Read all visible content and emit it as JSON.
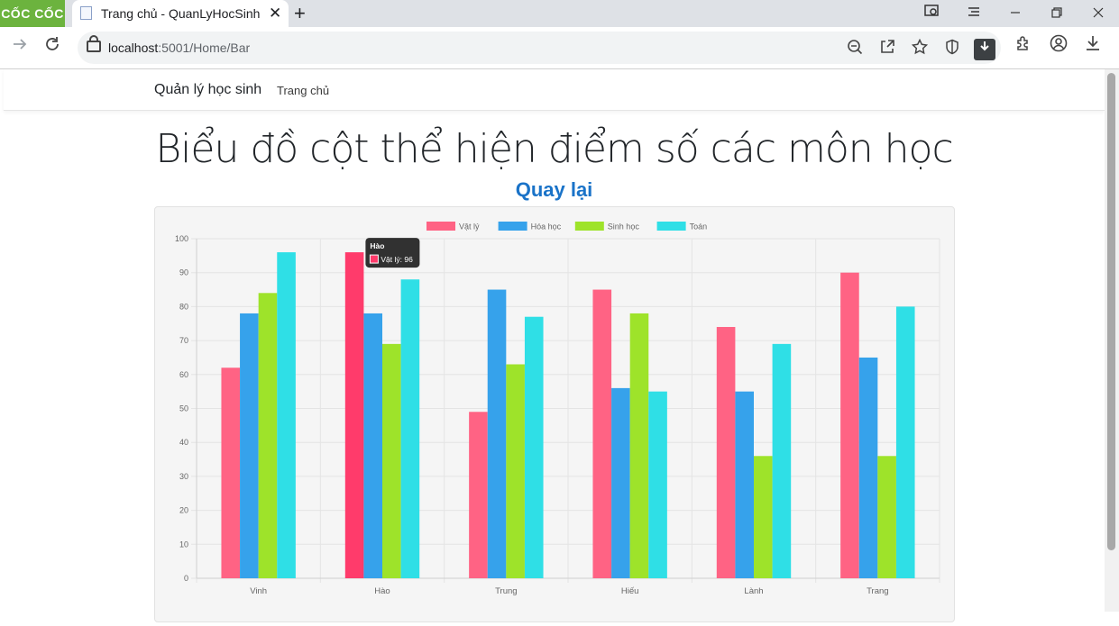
{
  "browser": {
    "brand": "CỐC CỐC",
    "tab_title": "Trang chủ - QuanLyHocSinh",
    "tab_close": "✕",
    "new_tab": "+",
    "url_host": "localhost",
    "url_path": ":5001/Home/Bar"
  },
  "navbar": {
    "brand": "Quản lý học sinh",
    "link_home": "Trang chủ"
  },
  "page": {
    "heading": "Biểu đồ cột thể hiện điểm số các môn học",
    "back_link": "Quay lại"
  },
  "tooltip": {
    "title": "Hào",
    "label": "Vật lý: 96"
  },
  "chart_data": {
    "type": "bar",
    "categories": [
      "Vinh",
      "Hào",
      "Trung",
      "Hiếu",
      "Lành",
      "Trang"
    ],
    "series": [
      {
        "name": "Vật lý",
        "color": "#ff6384",
        "values": [
          62,
          96,
          49,
          85,
          74,
          90
        ]
      },
      {
        "name": "Hóa học",
        "color": "#36a2eb",
        "values": [
          78,
          78,
          85,
          56,
          55,
          65
        ]
      },
      {
        "name": "Sinh học",
        "color": "#9ee32a",
        "values": [
          84,
          69,
          63,
          78,
          36,
          36
        ]
      },
      {
        "name": "Toán",
        "color": "#2fdfe6",
        "values": [
          96,
          88,
          77,
          55,
          69,
          80
        ]
      }
    ],
    "ylim": [
      0,
      100
    ],
    "yticks": [
      0,
      10,
      20,
      30,
      40,
      50,
      60,
      70,
      80,
      90,
      100
    ],
    "legend": "top",
    "grid": true,
    "highlight": {
      "category": "Hào",
      "series": "Vật lý",
      "color": "#ff3b6b"
    }
  }
}
